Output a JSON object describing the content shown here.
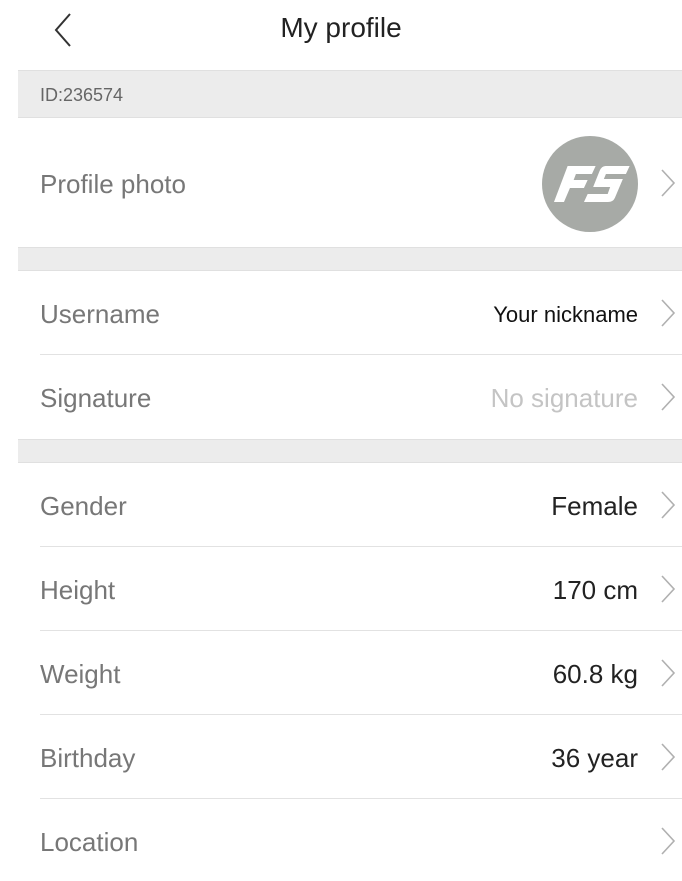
{
  "header": {
    "title": "My profile"
  },
  "id_bar": {
    "text": "ID:236574"
  },
  "profile_photo": {
    "label": "Profile photo",
    "logo_text": "FS"
  },
  "rows": [
    {
      "label": "Username",
      "value": "Your nickname"
    },
    {
      "label": "Signature",
      "value": "No signature"
    },
    {
      "label": "Gender",
      "value": "Female"
    },
    {
      "label": "Height",
      "value": "170 cm"
    },
    {
      "label": "Weight",
      "value": "60.8 kg"
    },
    {
      "label": "Birthday",
      "value": "36 year"
    },
    {
      "label": "Location",
      "value": ""
    }
  ],
  "colors": {
    "label": "#777777",
    "value": "#222222",
    "placeholder": "#c4c4c4",
    "section_bg": "#ececec",
    "avatar_bg": "#a7aaa6"
  },
  "icons": {
    "back": "chevron-left-icon",
    "row_arrow": "chevron-right-icon"
  }
}
